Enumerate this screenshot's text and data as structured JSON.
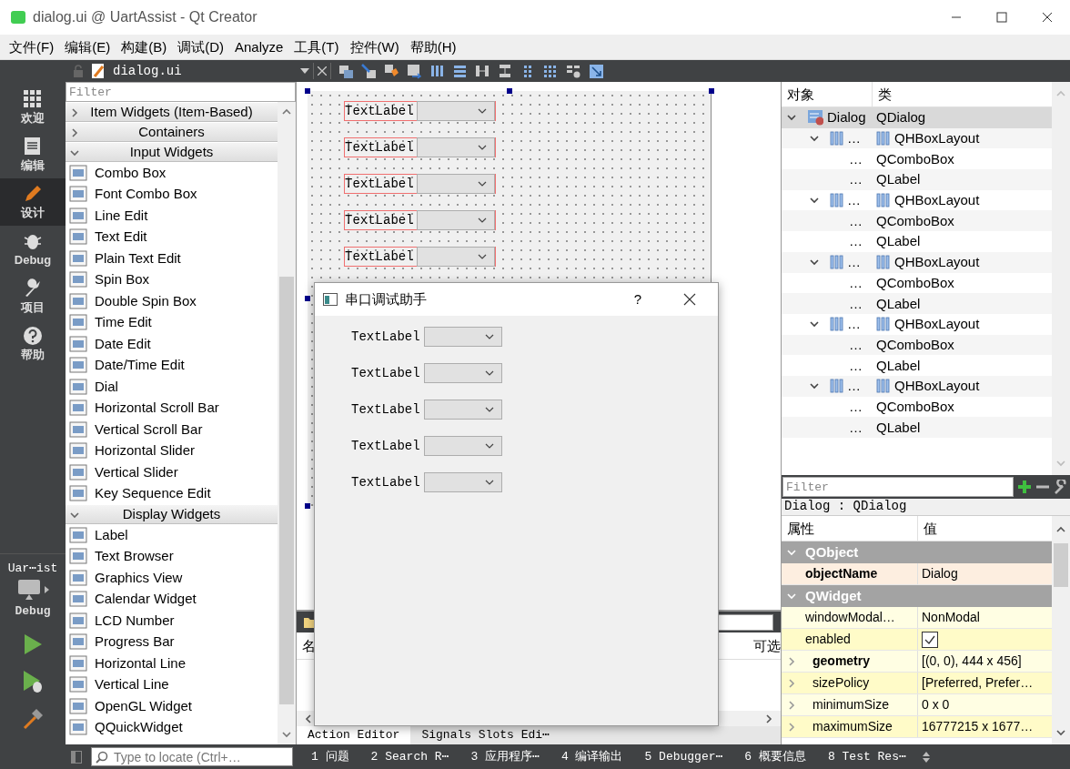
{
  "window": {
    "title": "dialog.ui @ UartAssist - Qt Creator"
  },
  "menu": [
    "文件(F)",
    "编辑(E)",
    "构建(B)",
    "调试(D)",
    "Analyze",
    "工具(T)",
    "控件(W)",
    "帮助(H)"
  ],
  "mode_bar": {
    "items": [
      {
        "label": "欢迎",
        "selected": false
      },
      {
        "label": "编辑",
        "selected": false
      },
      {
        "label": "设计",
        "selected": true
      },
      {
        "label": "Debug",
        "selected": false
      },
      {
        "label": "项目",
        "selected": false
      },
      {
        "label": "帮助",
        "selected": false
      }
    ],
    "kit": {
      "project": "Uar⋯ist",
      "build": "Debug"
    }
  },
  "editor": {
    "file": "dialog.ui"
  },
  "widget_box": {
    "filter_placeholder": "Filter",
    "categories": [
      {
        "title": "Item Widgets (Item-Based)",
        "expanded": false
      },
      {
        "title": "Containers",
        "expanded": false
      },
      {
        "title": "Input Widgets",
        "expanded": true,
        "items": [
          "Combo Box",
          "Font Combo Box",
          "Line Edit",
          "Text Edit",
          "Plain Text Edit",
          "Spin Box",
          "Double Spin Box",
          "Time Edit",
          "Date Edit",
          "Date/Time Edit",
          "Dial",
          "Horizontal Scroll Bar",
          "Vertical Scroll Bar",
          "Horizontal Slider",
          "Vertical Slider",
          "Key Sequence Edit"
        ]
      },
      {
        "title": "Display Widgets",
        "expanded": true,
        "items": [
          "Label",
          "Text Browser",
          "Graphics View",
          "Calendar Widget",
          "LCD Number",
          "Progress Bar",
          "Horizontal Line",
          "Vertical Line",
          "OpenGL Widget",
          "QQuickWidget"
        ]
      }
    ]
  },
  "form": {
    "rows": [
      {
        "label": "TextLabel"
      },
      {
        "label": "TextLabel"
      },
      {
        "label": "TextLabel"
      },
      {
        "label": "TextLabel"
      },
      {
        "label": "TextLabel"
      }
    ]
  },
  "preview_dialog": {
    "title": "串口调试助手",
    "help": "?",
    "rows": [
      {
        "label": "TextLabel"
      },
      {
        "label": "TextLabel"
      },
      {
        "label": "TextLabel"
      },
      {
        "label": "TextLabel"
      },
      {
        "label": "TextLabel"
      }
    ]
  },
  "action_editor": {
    "columns": [
      "名",
      "可选"
    ],
    "tabs": [
      {
        "label": "Action Editor",
        "selected": true
      },
      {
        "label": "Signals  Slots Edi⋯",
        "selected": false
      }
    ]
  },
  "object_inspector": {
    "columns": [
      "对象",
      "类"
    ],
    "tree": [
      {
        "object": "Dialog",
        "class": "QDialog",
        "kind": "dialog",
        "expanded": true,
        "selected": true,
        "children": [
          {
            "object": "…",
            "class": "QHBoxLayout",
            "kind": "layout",
            "expanded": true,
            "selected": false,
            "children": [
              {
                "object": "…",
                "class": "QComboBox",
                "selected": false
              },
              {
                "object": "…",
                "class": "QLabel",
                "selected": false
              }
            ]
          },
          {
            "object": "…",
            "class": "QHBoxLayout",
            "kind": "layout",
            "expanded": true,
            "selected": false,
            "children": [
              {
                "object": "…",
                "class": "QComboBox",
                "selected": false
              },
              {
                "object": "…",
                "class": "QLabel",
                "selected": false
              }
            ]
          },
          {
            "object": "…",
            "class": "QHBoxLayout",
            "kind": "layout",
            "expanded": true,
            "selected": false,
            "children": [
              {
                "object": "…",
                "class": "QComboBox",
                "selected": false
              },
              {
                "object": "…",
                "class": "QLabel",
                "selected": false
              }
            ]
          },
          {
            "object": "…",
            "class": "QHBoxLayout",
            "kind": "layout",
            "expanded": true,
            "selected": false,
            "children": [
              {
                "object": "…",
                "class": "QComboBox",
                "selected": false
              },
              {
                "object": "…",
                "class": "QLabel",
                "selected": false
              }
            ]
          },
          {
            "object": "…",
            "class": "QHBoxLayout",
            "kind": "layout",
            "expanded": true,
            "selected": false,
            "children": [
              {
                "object": "…",
                "class": "QComboBox",
                "selected": false
              },
              {
                "object": "…",
                "class": "QLabel",
                "selected": false
              }
            ]
          }
        ]
      }
    ]
  },
  "property_editor": {
    "filter_placeholder": "Filter",
    "object": "Dialog : QDialog",
    "columns": [
      "属性",
      "值"
    ],
    "groups": [
      {
        "name": "QObject",
        "expanded": true,
        "properties": [
          {
            "name": "objectName",
            "kind": "text",
            "value": "Dialog",
            "modified": true,
            "expandable": false
          }
        ]
      },
      {
        "name": "QWidget",
        "expanded": true,
        "properties": [
          {
            "name": "windowModal…",
            "kind": "text",
            "value": "NonModal",
            "modified": false,
            "expandable": false
          },
          {
            "name": "enabled",
            "kind": "checkbox",
            "checked": true,
            "modified": false,
            "expandable": false
          },
          {
            "name": "geometry",
            "kind": "text",
            "value": "[(0, 0), 444 x 456]",
            "modified": true,
            "expandable": true
          },
          {
            "name": "sizePolicy",
            "kind": "text",
            "value": "[Preferred, Prefer…",
            "modified": false,
            "expandable": true
          },
          {
            "name": "minimumSize",
            "kind": "text",
            "value": "0 x 0",
            "modified": false,
            "expandable": true
          },
          {
            "name": "maximumSize",
            "kind": "text",
            "value": "16777215 x 1677…",
            "modified": false,
            "expandable": true
          }
        ]
      }
    ]
  },
  "status_bar": {
    "locator_placeholder": "Type to locate (Ctrl+…",
    "panes": [
      "1 问题",
      "2 Search R⋯",
      "3 应用程序⋯",
      "4 编译输出",
      "5 Debugger⋯",
      "6 概要信息",
      "8 Test Res⋯"
    ]
  }
}
